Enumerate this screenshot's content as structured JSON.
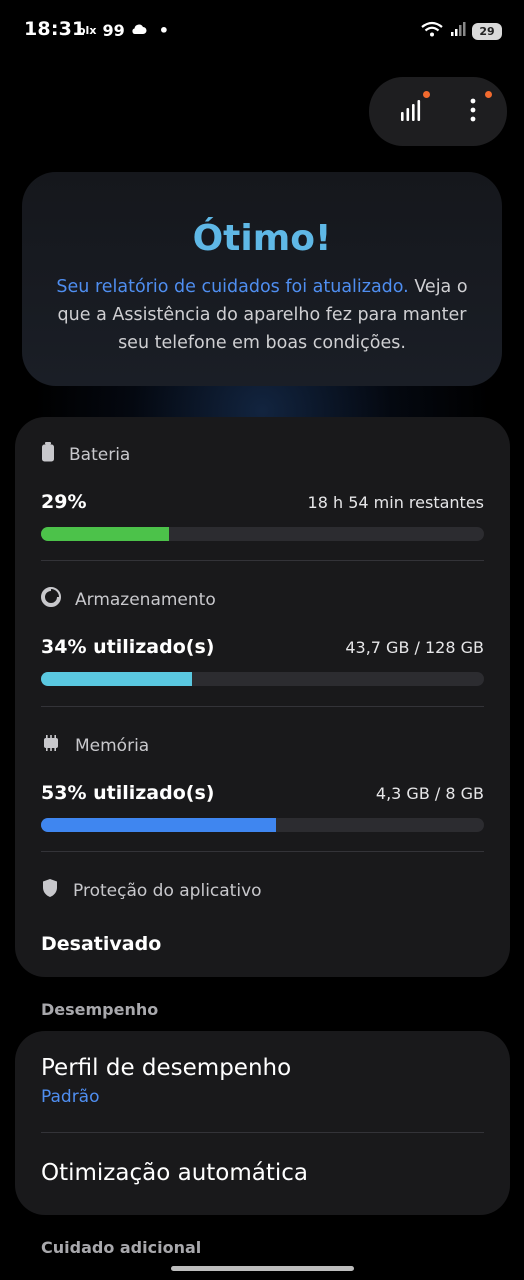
{
  "status_bar": {
    "time": "18:31",
    "left_icons": [
      "olx",
      "99",
      "cloud-icon",
      "•"
    ],
    "battery_level": "29"
  },
  "hero": {
    "title": "Ótimo!",
    "link_text": "Seu relatório de cuidados foi atualizado.",
    "body_text": " Veja o que a Assistência do aparelho fez para manter seu telefone em boas condições."
  },
  "device_status": {
    "battery": {
      "label": "Bateria",
      "value": "29%",
      "detail": "18 h 54 min restantes",
      "fill": 0.29,
      "color": "#4cc24a"
    },
    "storage": {
      "label": "Armazenamento",
      "value": "34% utilizado(s)",
      "detail": "43,7 GB / 128 GB",
      "fill": 0.34,
      "color": "#5ac8e0"
    },
    "memory": {
      "label": "Memória",
      "value": "53% utilizado(s)",
      "detail": "4,3 GB / 8 GB",
      "fill": 0.53,
      "color": "#3f86f0"
    },
    "app_protection": {
      "label": "Proteção do aplicativo",
      "value": "Desativado"
    }
  },
  "performance": {
    "section_label": "Desempenho",
    "profile_title": "Perfil de desempenho",
    "profile_value": "Padrão",
    "auto_opt_title": "Otimização automática"
  },
  "additional_care": {
    "section_label": "Cuidado adicional"
  },
  "colors": {
    "accent_blue": "#4f8ef0",
    "title_blue": "#5fb8e6",
    "notification_dot": "#f26a2e"
  }
}
